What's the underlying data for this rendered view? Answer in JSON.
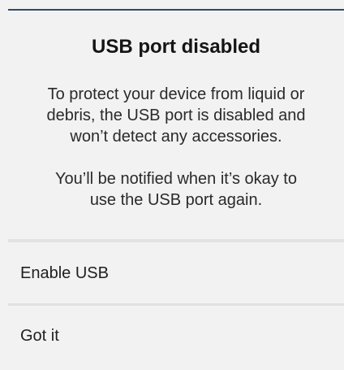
{
  "dialog": {
    "title": "USB port disabled",
    "message_1": "To protect your device from liquid or\ndebris, the USB port is disabled and\nwon’t detect any accessories.",
    "message_2": "You’ll be notified when it’s okay to\nuse the USB port again.",
    "actions": [
      {
        "label": "Enable USB"
      },
      {
        "label": "Got it"
      }
    ]
  }
}
